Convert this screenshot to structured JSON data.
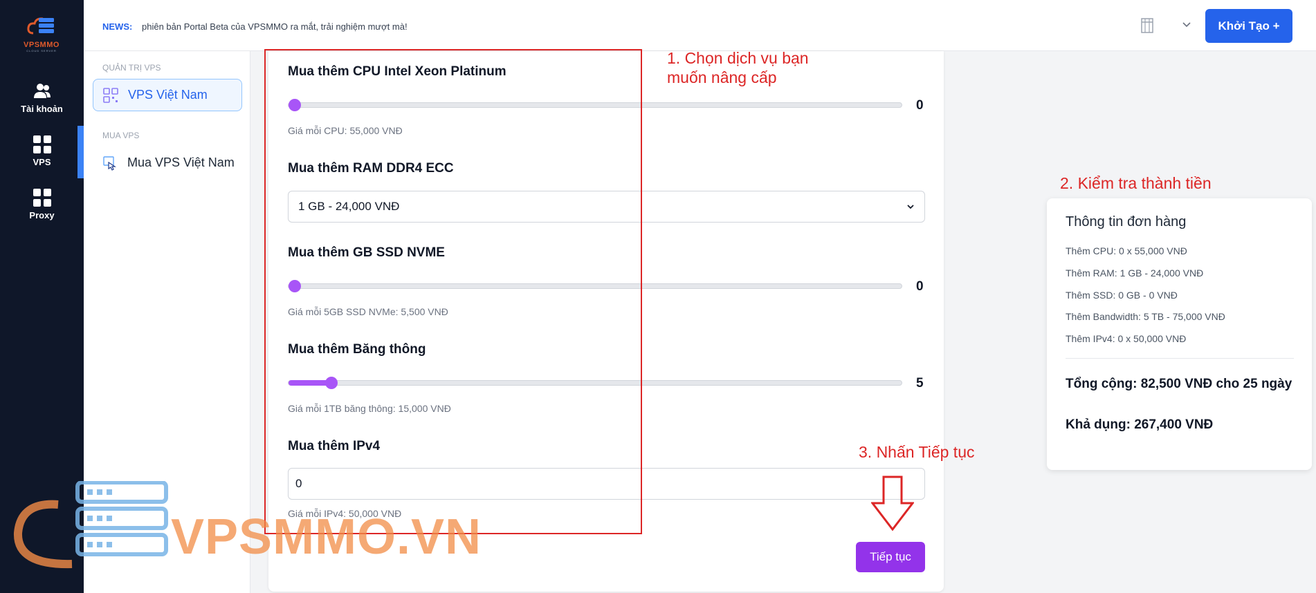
{
  "rail": {
    "brand": "VPSMMO",
    "tagline": "CLOUD SERVER",
    "items": [
      {
        "label": "Tài khoản",
        "icon": "users-icon"
      },
      {
        "label": "VPS",
        "icon": "grid-icon"
      },
      {
        "label": "Proxy",
        "icon": "grid-icon"
      }
    ]
  },
  "topbar": {
    "news_label": "NEWS:",
    "news_text": "phiên bản Portal Beta của VPSMMO ra mắt, trải nghiệm mượt mà!",
    "create_button": "Khởi Tạo +"
  },
  "sidebar": {
    "section1": "QUẢN TRỊ VPS",
    "item1": "VPS Việt Nam",
    "section2": "MUA VPS",
    "item2": "Mua VPS Việt Nam"
  },
  "form": {
    "cpu": {
      "label": "Mua thêm CPU Intel Xeon Platinum",
      "value": "0",
      "hint": "Giá mỗi CPU: 55,000 VNĐ",
      "fraction": 0
    },
    "ram": {
      "label": "Mua thêm RAM DDR4 ECC",
      "selected": "1 GB - 24,000 VNĐ"
    },
    "ssd": {
      "label": "Mua thêm GB SSD NVME",
      "value": "0",
      "hint": "Giá mỗi 5GB SSD NVMe: 5,500 VNĐ",
      "fraction": 0
    },
    "bandwidth": {
      "label": "Mua thêm Băng thông",
      "value": "5",
      "hint": "Giá mỗi 1TB băng thông: 15,000 VNĐ",
      "fraction": 0.07
    },
    "ipv4": {
      "label": "Mua thêm IPv4",
      "value": "0",
      "hint": "Giá mỗi IPv4: 50,000 VNĐ"
    },
    "next_button": "Tiếp tục"
  },
  "order": {
    "title": "Thông tin đơn hàng",
    "lines": [
      "Thêm CPU: 0 x 55,000 VNĐ",
      "Thêm RAM: 1 GB - 24,000 VNĐ",
      "Thêm SSD: 0 GB - 0 VNĐ",
      "Thêm Bandwidth: 5 TB - 75,000 VNĐ",
      "Thêm IPv4: 0 x 50,000 VNĐ"
    ],
    "total": "Tổng cộng: 82,500 VNĐ cho 25 ngày",
    "available": "Khả dụng: 267,400 VNĐ"
  },
  "annotations": {
    "step1_line1": "1. Chọn dịch vụ bạn",
    "step1_line2": "muốn nâng cấp",
    "step2": "2. Kiểm tra thành tiền",
    "step3": "3. Nhấn Tiếp tục"
  },
  "watermark": "VPSMMO.VN",
  "colors": {
    "accent": "#2563eb",
    "purple": "#9333ea",
    "annotation": "#dc2626",
    "rail": "#0f1729"
  }
}
